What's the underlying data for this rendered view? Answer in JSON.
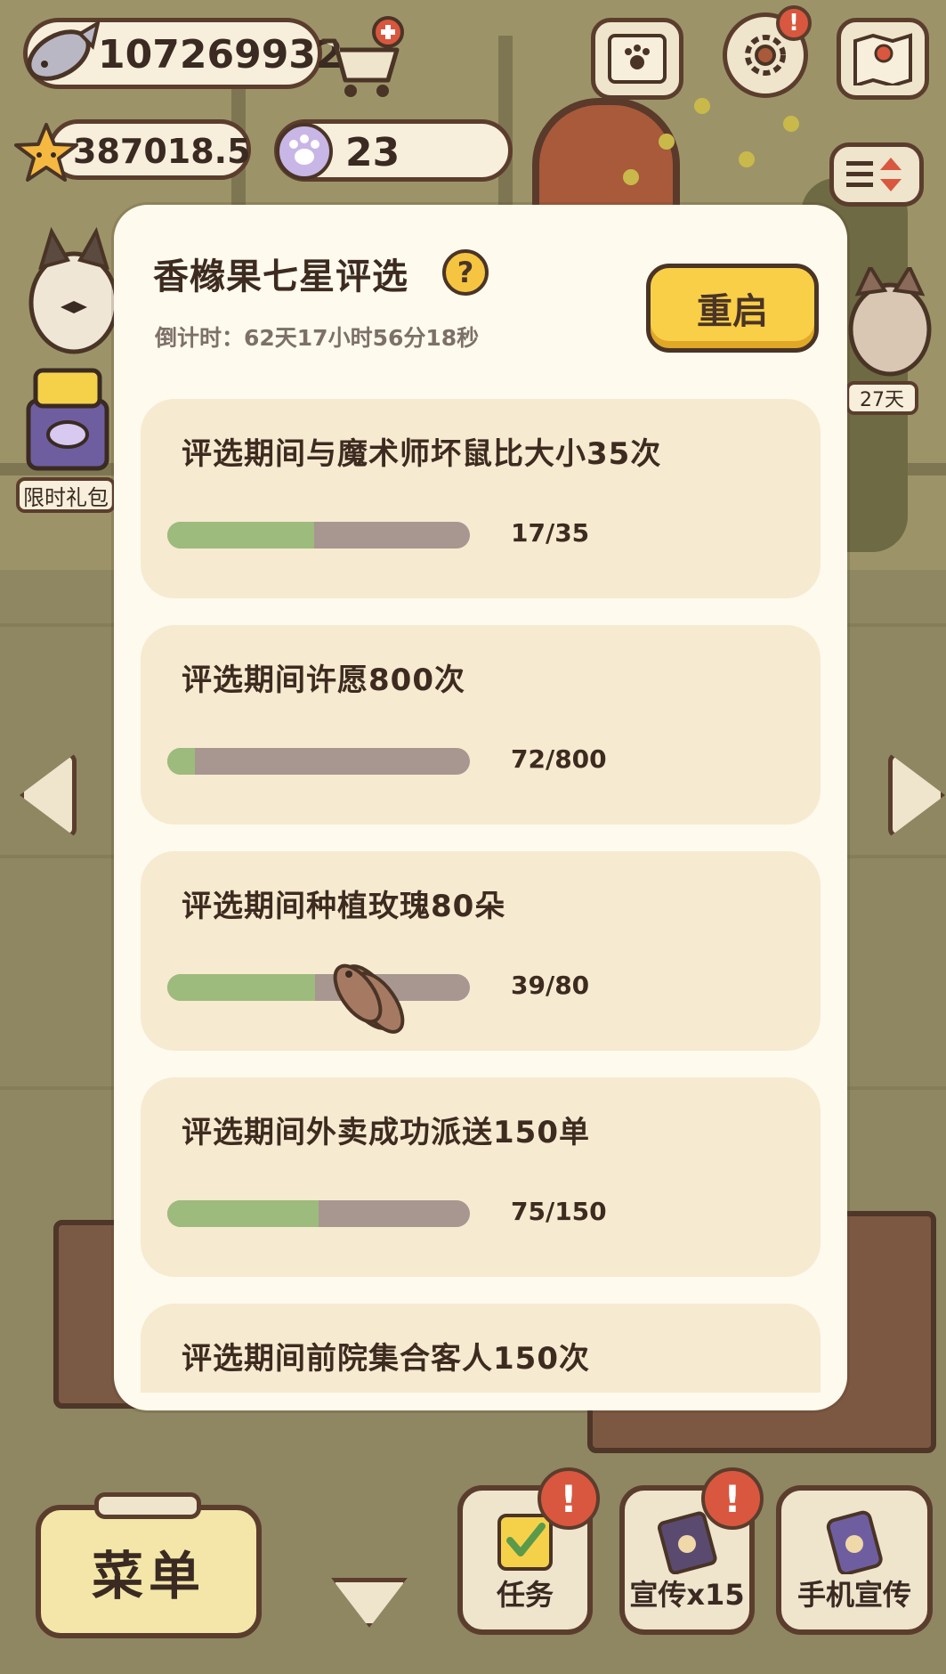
{
  "hud": {
    "fish_count": "107269932",
    "star_count": "387018.5",
    "paw_count": "23"
  },
  "side": {
    "gift_label": "限时礼包",
    "days_label": "27天"
  },
  "modal": {
    "title": "香橼果七星评选",
    "help_symbol": "?",
    "countdown": "倒计时：62天17小时56分18秒",
    "restart_label": "重启",
    "tasks": [
      {
        "label": "评选期间与魔术师坏鼠比大小35次",
        "progress_text": "17/35",
        "current": 17,
        "target": 35
      },
      {
        "label": "评选期间许愿800次",
        "progress_text": "72/800",
        "current": 72,
        "target": 800
      },
      {
        "label": "评选期间种植玫瑰80朵",
        "progress_text": "39/80",
        "current": 39,
        "target": 80
      },
      {
        "label": "评选期间外卖成功派送150单",
        "progress_text": "75/150",
        "current": 75,
        "target": 150
      },
      {
        "label": "评选期间前院集合客人150次",
        "progress_text": "",
        "current": null,
        "target": 150
      }
    ]
  },
  "bottom": {
    "menu_label": "菜单",
    "task_label": "任务",
    "promo_label": "宣传x15",
    "phone_promo_label": "手机宣传",
    "alert_symbol": "!"
  },
  "colors": {
    "panel_bg": "#fffaee",
    "card_bg": "#f6ead0",
    "bar_fill": "#9dbb7c",
    "bar_track": "#a89691",
    "button_yellow": "#f9cf47",
    "outline": "#4a3426",
    "alert_red": "#d9573e"
  }
}
